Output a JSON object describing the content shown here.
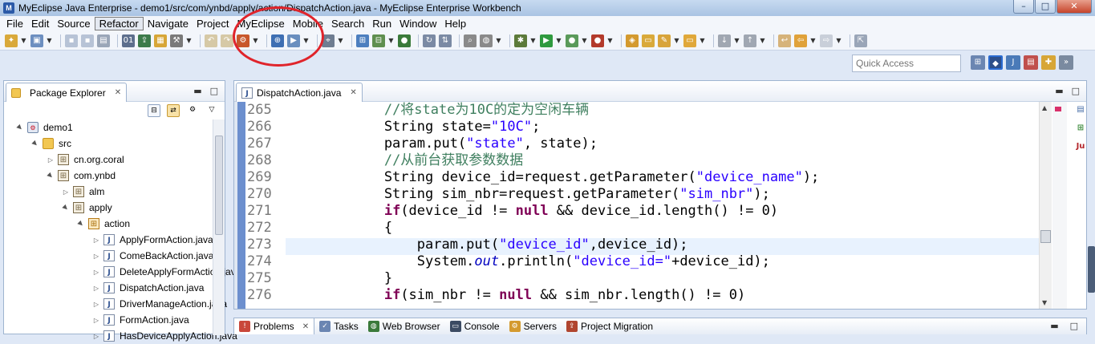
{
  "window": {
    "title": "MyEclipse Java Enterprise - demo1/src/com/ynbd/apply/action/DispatchAction.java - MyEclipse Enterprise Workbench",
    "minimize": "–",
    "maximize": "□",
    "close": "✕"
  },
  "menu": [
    "File",
    "Edit",
    "Source",
    "Refactor",
    "Navigate",
    "Project",
    "MyEclipse",
    "Mobile",
    "Search",
    "Run",
    "Window",
    "Help"
  ],
  "menu_active": "Refactor",
  "quick_access": {
    "placeholder": "Quick Access"
  },
  "package_explorer": {
    "tab_label": "Package Explorer",
    "tree": [
      {
        "label": "demo1",
        "icon": "project-icon",
        "twisty": "▲",
        "indent": 0
      },
      {
        "label": "src",
        "icon": "source-folder-icon",
        "twisty": "▲",
        "indent": 1
      },
      {
        "label": "cn.org.coral",
        "icon": "package-icon",
        "twisty": "▷",
        "indent": 2
      },
      {
        "label": "com.ynbd",
        "icon": "package-icon",
        "twisty": "▲",
        "indent": 2
      },
      {
        "label": "alm",
        "icon": "package-icon",
        "twisty": "▷",
        "indent": 3
      },
      {
        "label": "apply",
        "icon": "package-icon",
        "twisty": "▲",
        "indent": 3
      },
      {
        "label": "action",
        "icon": "package-open-icon",
        "twisty": "▲",
        "indent": 4
      },
      {
        "label": "ApplyFormAction.java",
        "icon": "java-file-icon",
        "twisty": "▷",
        "indent": 5
      },
      {
        "label": "ComeBackAction.java",
        "icon": "java-file-icon",
        "twisty": "▷",
        "indent": 5
      },
      {
        "label": "DeleteApplyFormAction.java",
        "icon": "java-file-icon",
        "twisty": "▷",
        "indent": 5
      },
      {
        "label": "DispatchAction.java",
        "icon": "java-file-icon",
        "twisty": "▷",
        "indent": 5
      },
      {
        "label": "DriverManageAction.java",
        "icon": "java-file-icon",
        "twisty": "▷",
        "indent": 5
      },
      {
        "label": "FormAction.java",
        "icon": "java-file-icon",
        "twisty": "▷",
        "indent": 5
      },
      {
        "label": "HasDeviceApplyAction.java",
        "icon": "java-file-icon",
        "twisty": "▷",
        "indent": 5
      }
    ]
  },
  "editor": {
    "tab_label": "DispatchAction.java",
    "lines": [
      {
        "num": "265",
        "segments": [
          {
            "t": "            ",
            "c": "plain"
          },
          {
            "t": "//将state为10C的定为空闲车辆",
            "c": "comment"
          }
        ]
      },
      {
        "num": "266",
        "segments": [
          {
            "t": "            String state=",
            "c": "plain"
          },
          {
            "t": "\"10C\"",
            "c": "string"
          },
          {
            "t": ";",
            "c": "plain"
          }
        ]
      },
      {
        "num": "267",
        "segments": [
          {
            "t": "            param.put(",
            "c": "plain"
          },
          {
            "t": "\"state\"",
            "c": "string"
          },
          {
            "t": ", state);",
            "c": "plain"
          }
        ]
      },
      {
        "num": "268",
        "segments": [
          {
            "t": "            ",
            "c": "plain"
          },
          {
            "t": "//从前台获取参数数据",
            "c": "comment"
          }
        ]
      },
      {
        "num": "269",
        "segments": [
          {
            "t": "            String device_id=request.getParameter(",
            "c": "plain"
          },
          {
            "t": "\"device_name\"",
            "c": "string"
          },
          {
            "t": ");",
            "c": "plain"
          }
        ]
      },
      {
        "num": "270",
        "segments": [
          {
            "t": "            String sim_nbr=request.getParameter(",
            "c": "plain"
          },
          {
            "t": "\"sim_nbr\"",
            "c": "string"
          },
          {
            "t": ");",
            "c": "plain"
          }
        ]
      },
      {
        "num": "271",
        "segments": [
          {
            "t": "            ",
            "c": "plain"
          },
          {
            "t": "if",
            "c": "keyword"
          },
          {
            "t": "(device_id != ",
            "c": "plain"
          },
          {
            "t": "null",
            "c": "keyword"
          },
          {
            "t": " && device_id.length() != 0)",
            "c": "plain"
          }
        ]
      },
      {
        "num": "272",
        "segments": [
          {
            "t": "            {",
            "c": "plain"
          }
        ]
      },
      {
        "num": "273",
        "segments": [
          {
            "t": "                param.put(",
            "c": "plain"
          },
          {
            "t": "\"device_id\"",
            "c": "string"
          },
          {
            "t": ",device_id);",
            "c": "plain"
          }
        ]
      },
      {
        "num": "274",
        "segments": [
          {
            "t": "                System.",
            "c": "plain"
          },
          {
            "t": "out",
            "c": "field"
          },
          {
            "t": ".println(",
            "c": "plain"
          },
          {
            "t": "\"device_id=\"",
            "c": "string"
          },
          {
            "t": "+device_id);",
            "c": "plain"
          }
        ]
      },
      {
        "num": "275",
        "segments": [
          {
            "t": "            }",
            "c": "plain"
          }
        ]
      },
      {
        "num": "276",
        "segments": [
          {
            "t": "            ",
            "c": "plain"
          },
          {
            "t": "if",
            "c": "keyword"
          },
          {
            "t": "(sim_nbr != ",
            "c": "plain"
          },
          {
            "t": "null",
            "c": "keyword"
          },
          {
            "t": " && sim_nbr.length() != 0)",
            "c": "plain"
          }
        ]
      }
    ],
    "colors": {
      "comment": "#3f7f5f",
      "string": "#2a00ff",
      "keyword": "#7f0055",
      "field": "#0000c0",
      "plain": "#000000"
    }
  },
  "bottom_tabs": [
    {
      "label": "Problems",
      "icon": "problems-icon",
      "active": true
    },
    {
      "label": "Tasks",
      "icon": "tasks-icon",
      "active": false
    },
    {
      "label": "Web Browser",
      "icon": "web-browser-icon",
      "active": false
    },
    {
      "label": "Console",
      "icon": "console-icon",
      "active": false
    },
    {
      "label": "Servers",
      "icon": "servers-icon",
      "active": false
    },
    {
      "label": "Project Migration",
      "icon": "project-migration-icon",
      "active": false
    }
  ],
  "right_icons": [
    "outline-icon",
    "hierarchy-icon",
    "junit-icon"
  ],
  "right_icon_text": {
    "junit": "Ju"
  },
  "accent": {
    "highlight_circle": "#e0242b"
  }
}
